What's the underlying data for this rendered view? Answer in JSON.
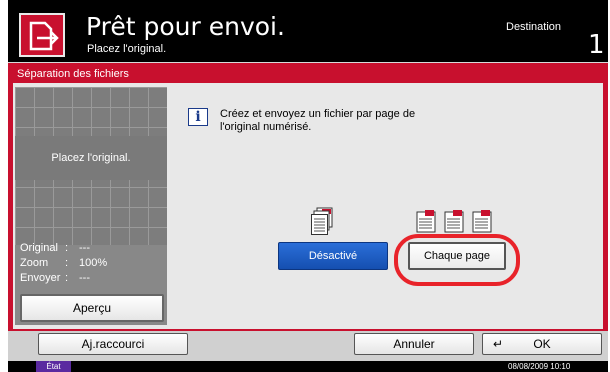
{
  "header": {
    "title": "Prêt pour envoi.",
    "subtitle": "Placez l'original.",
    "destination_label": "Destination",
    "destination_count": "1",
    "icon": "send-document-icon"
  },
  "panel": {
    "title": "Séparation des fichiers",
    "preview": {
      "message": "Placez l'original.",
      "info": [
        {
          "key": "Original",
          "sep": ":",
          "value": "---"
        },
        {
          "key": "Zoom",
          "sep": ":",
          "value": "100%"
        },
        {
          "key": "Envoyer",
          "sep": ":",
          "value": "---"
        }
      ],
      "preview_button": "Aperçu"
    },
    "message_line1": "Créez et envoyez un fichier par page de",
    "message_line2": "l'original numérisé.",
    "info_icon_glyph": "i",
    "options": [
      {
        "label": "Désactivé",
        "selected": true,
        "icon": "single-file-icon"
      },
      {
        "label": "Chaque page",
        "selected": false,
        "icon": "multiple-files-icon"
      }
    ]
  },
  "bottom": {
    "shortcut_button": "Aj.raccourci",
    "cancel_button": "Annuler",
    "ok_button": "OK"
  },
  "status": {
    "state_label": "État",
    "datetime": "08/08/2009    10:10"
  },
  "colors": {
    "accent": "#c8102e",
    "selected_button": "#1e5ec8",
    "highlight": "#e8232a"
  }
}
